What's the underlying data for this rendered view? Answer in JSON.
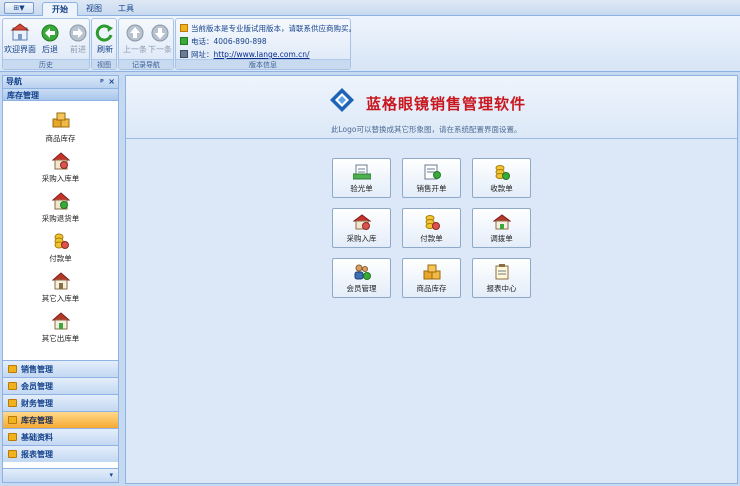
{
  "ribbon": {
    "app_button": "⊞▼",
    "tabs": [
      "开始",
      "视图",
      "工具"
    ],
    "groups": {
      "history": {
        "label": "历史",
        "buttons": [
          "欢迎界面",
          "后退",
          "前进"
        ]
      },
      "view": {
        "label": "视图",
        "buttons": [
          "刷新"
        ]
      },
      "record_nav": {
        "label": "记录导航",
        "buttons": [
          "上一条",
          "下一条"
        ]
      },
      "version": {
        "label": "版本信息",
        "notice": "当前版本是专业版试用版本，请联系供应商购买。",
        "phone_label": "电话：",
        "phone": "4006-890-898",
        "site_label": "网址：",
        "site": "http://www.lange.com.cn/"
      }
    }
  },
  "nav": {
    "title": "导航",
    "pin": "ᵖ",
    "close": "×",
    "section": "库存管理",
    "items": [
      "商品库存",
      "采购入库单",
      "采购退货单",
      "付款单",
      "其它入库单",
      "其它出库单"
    ],
    "categories": [
      "销售管理",
      "会员管理",
      "财务管理",
      "库存管理",
      "基础资料",
      "报表管理"
    ],
    "active_category": "库存管理",
    "scroll_arrow": "▼",
    "bottom_arrow": "▾"
  },
  "main": {
    "brand_name": "蓝格眼镜销售管理软件",
    "brand_sub": "此Logo可以替换成其它形象图，请在系统配置界面设置。",
    "tiles": [
      "验光单",
      "销售开单",
      "收款单",
      "采购入库",
      "付款单",
      "调拨单",
      "会员管理",
      "商品库存",
      "报表中心"
    ]
  },
  "colors": {
    "brand_red": "#c8171e",
    "brand_blue": "#1e63b8",
    "ribbon_bg": "#dfe9f5",
    "active_category": "#f6a933"
  }
}
